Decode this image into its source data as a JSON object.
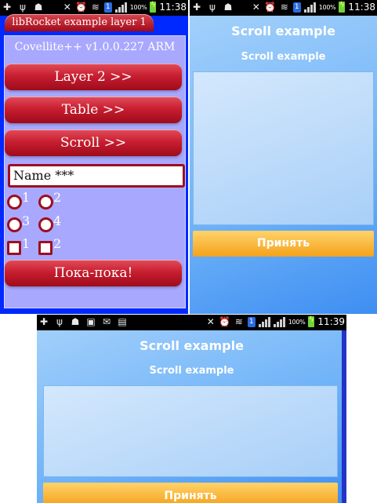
{
  "status_left_icons": [
    "plus-icon",
    "usb-icon",
    "android-icon",
    "mute-icon",
    "alarm-icon",
    "wifi-icon",
    "sim-icon",
    "signal-icon"
  ],
  "status": {
    "battery_percent": "100%",
    "p1_time": "11:38",
    "p2_time": "11:38",
    "p3_time": "11:39",
    "sim_label": "1"
  },
  "panel1": {
    "tab_title": "libRocket example layer 1",
    "version": "Covellite++ v1.0.0.227 ARM",
    "buttons": [
      "Layer 2 >>",
      "Table >>",
      "Scroll >>"
    ],
    "name_value": "Name ***",
    "radios": [
      "1",
      "2",
      "3",
      "4"
    ],
    "checks": [
      "1",
      "2"
    ],
    "bye_button": "Пока-пока!"
  },
  "panel2": {
    "title": "Scroll example",
    "subtitle": "Scroll example",
    "accept_button": "Принять"
  },
  "panel3": {
    "title": "Scroll example",
    "subtitle": "Scroll example",
    "accept_button": "Принять"
  },
  "colors": {
    "p1_background": "#0029ff",
    "p1_body": "#a9a8ff",
    "accent_red": "#c81f31",
    "scroll_blue": "#6eb2f8",
    "accept_orange": "#f4a21b"
  }
}
